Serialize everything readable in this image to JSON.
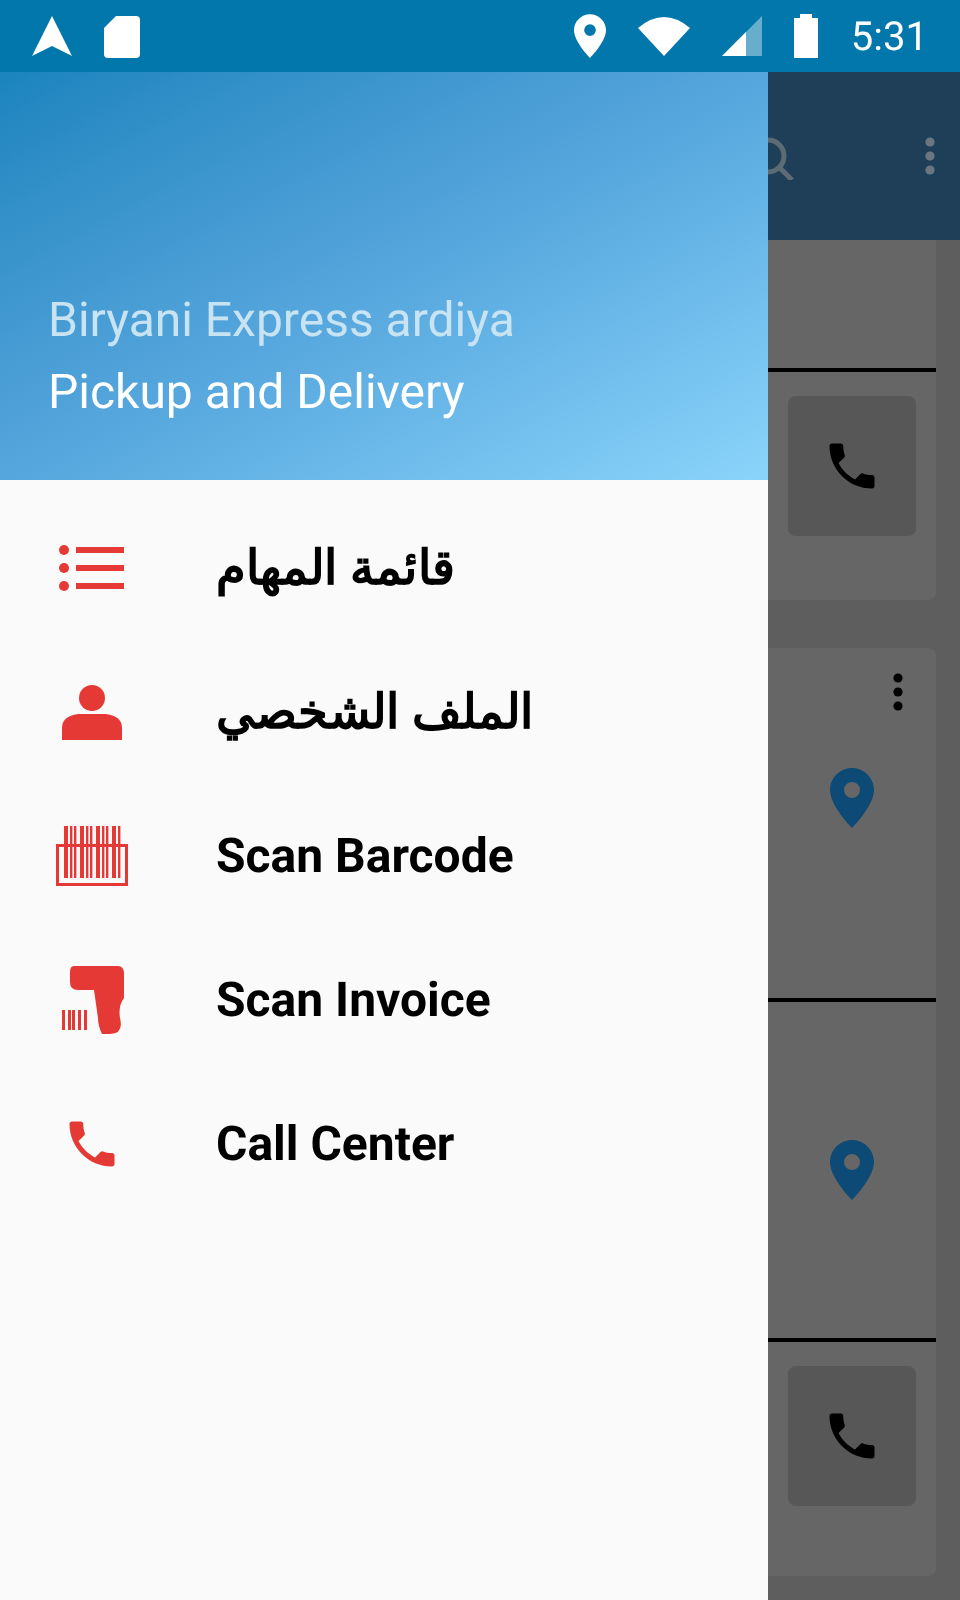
{
  "status_bar": {
    "time": "5:31"
  },
  "drawer": {
    "title": "Biryani Express ardiya",
    "subtitle": "Pickup and Delivery",
    "items": [
      {
        "kind": "list",
        "label": "قائمة المهام"
      },
      {
        "kind": "person",
        "label": "الملف الشخصي"
      },
      {
        "kind": "barcode",
        "label": "Scan Barcode"
      },
      {
        "kind": "scanner",
        "label": "Scan Invoice"
      },
      {
        "kind": "phone",
        "label": "Call Center"
      }
    ]
  }
}
